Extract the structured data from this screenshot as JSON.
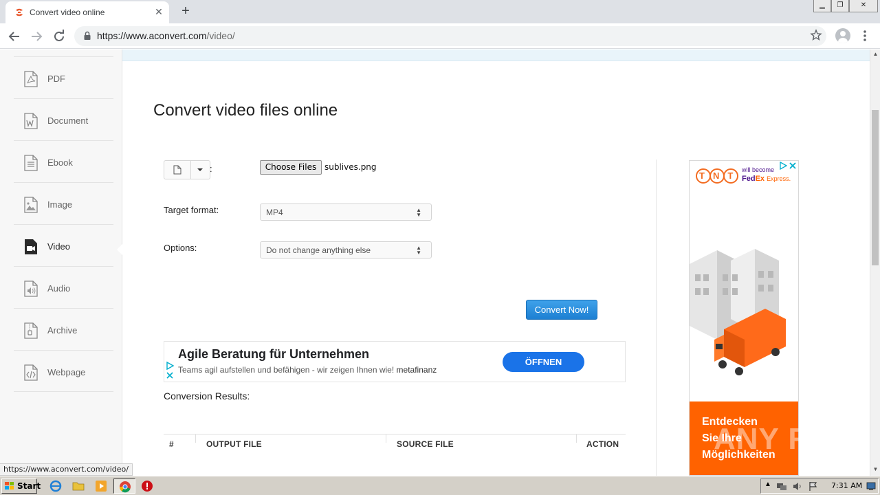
{
  "browser": {
    "tab_title": "Convert video online",
    "new_tab_label": "+",
    "url_host": "https://www.aconvert.com",
    "url_path": "/video/",
    "window_controls": [
      "minimize-icon",
      "restore-icon",
      "close-icon"
    ]
  },
  "sidebar": {
    "items": [
      {
        "label": "PDF",
        "icon": "pdf-file-icon"
      },
      {
        "label": "Document",
        "icon": "word-document-icon"
      },
      {
        "label": "Ebook",
        "icon": "ebook-icon"
      },
      {
        "label": "Image",
        "icon": "image-file-icon"
      },
      {
        "label": "Video",
        "icon": "video-camera-icon",
        "active": true
      },
      {
        "label": "Audio",
        "icon": "audio-file-icon"
      },
      {
        "label": "Archive",
        "icon": "archive-file-icon"
      },
      {
        "label": "Webpage",
        "icon": "code-file-icon"
      }
    ]
  },
  "main": {
    "heading": "Convert video files online",
    "file_source_colon": ":",
    "choose_files_label": "Choose Files",
    "chosen_file": "sublives.png",
    "target_format_label": "Target format:",
    "target_format_value": "MP4",
    "options_label": "Options:",
    "options_value": "Do not change anything else",
    "convert_button": "Convert Now!",
    "results_label": "Conversion Results:",
    "table_headers": [
      "#",
      "OUTPUT FILE",
      "SOURCE FILE",
      "ACTION"
    ]
  },
  "ad_banner": {
    "title": "Agile Beratung für Unternehmen",
    "subtitle": "Teams agil aufstellen und befähigen - wir zeigen Ihnen wie!",
    "brand": "metafinanz",
    "cta": "ÖFFNEN"
  },
  "side_ad": {
    "tnt": "TNT",
    "will_become": "will become",
    "fedex_fed": "Fed",
    "fedex_ex": "Ex",
    "fedex_express": "Express.",
    "slogan_lines": [
      "Entdecken",
      "Sie Ihre",
      "Möglichkeiten"
    ]
  },
  "status_link": "https://www.aconvert.com/video/",
  "watermark": "ANY RUN",
  "taskbar": {
    "start_label": "Start",
    "clock": "7:31 AM"
  },
  "colors": {
    "accent_blue": "#1d7fd2",
    "ad_cta_blue": "#1a73e8",
    "fedex_purple": "#4d148c",
    "fedex_orange": "#ff6200",
    "tnt_orange": "#f36c21"
  }
}
